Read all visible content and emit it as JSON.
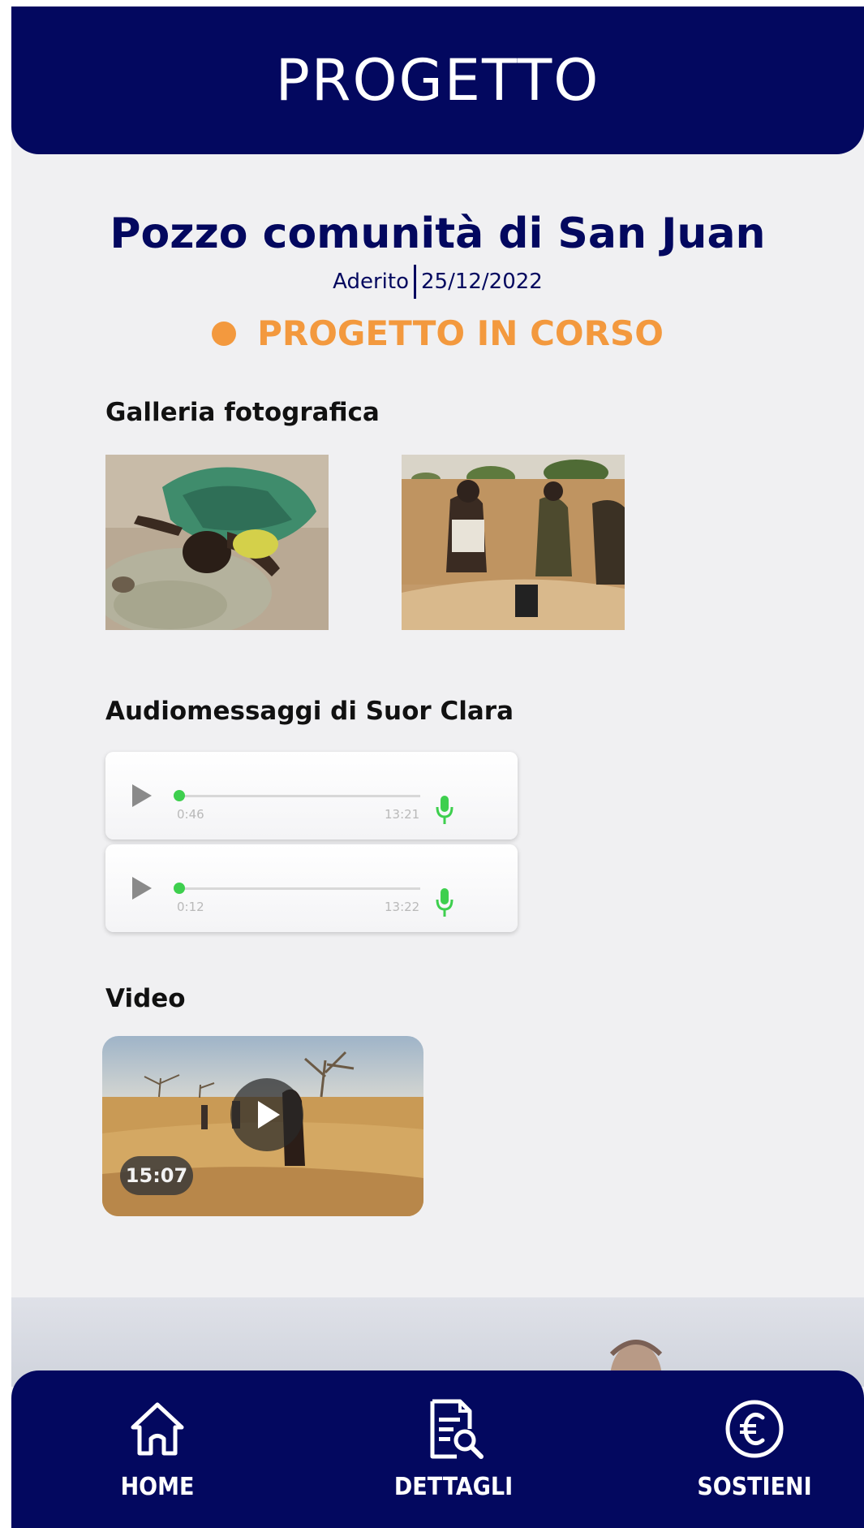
{
  "header": {
    "title": "PROGETTO"
  },
  "project": {
    "name": "Pozzo comunità di San Juan",
    "membership": "Aderito",
    "date": "25/12/2022",
    "status": "PROGETTO IN CORSO",
    "status_color": "#f3993e"
  },
  "gallery": {
    "title": "Galleria fotografica",
    "photos": [
      {
        "icon": "photo-child-drinking"
      },
      {
        "icon": "photo-people-at-well"
      }
    ]
  },
  "audio": {
    "title": "Audiomessaggi di Suor Clara",
    "messages": [
      {
        "current": "0:46",
        "total": "13:21"
      },
      {
        "current": "0:12",
        "total": "13:22"
      }
    ]
  },
  "video": {
    "title": "Video",
    "duration": "15:07"
  },
  "nav": {
    "items": [
      {
        "label": "HOME",
        "icon": "home-icon"
      },
      {
        "label": "DETTAGLI",
        "icon": "document-search-icon"
      },
      {
        "label": "SOSTIENI",
        "icon": "euro-icon"
      }
    ]
  },
  "colors": {
    "primary": "#03085f",
    "accent": "#f3993e",
    "background": "#f0f0f2",
    "progress": "#3ecf4e"
  }
}
